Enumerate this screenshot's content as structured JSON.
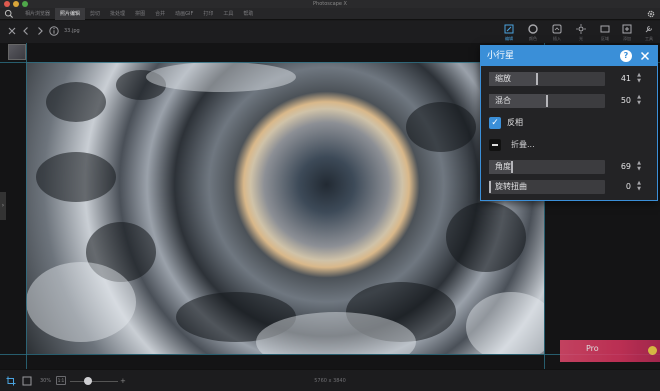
{
  "app": {
    "title": "Photoscape X"
  },
  "tabs": [
    {
      "label": "相片浏览器",
      "active": false
    },
    {
      "label": "照片编辑",
      "active": true
    },
    {
      "label": "剪切",
      "active": false
    },
    {
      "label": "批处理",
      "active": false
    },
    {
      "label": "拼图",
      "active": false
    },
    {
      "label": "合并",
      "active": false
    },
    {
      "label": "动画GIF",
      "active": false
    },
    {
      "label": "打印",
      "active": false
    },
    {
      "label": "工具",
      "active": false
    },
    {
      "label": "帮助",
      "active": false
    }
  ],
  "toolbar": {
    "file_name": "33.jpg",
    "tools": [
      {
        "label": "编辑",
        "icon": "edit-icon",
        "active": true
      },
      {
        "label": "颜色",
        "icon": "color-icon",
        "active": false
      },
      {
        "label": "插入",
        "icon": "insert-icon",
        "active": false
      },
      {
        "label": "光",
        "icon": "light-icon",
        "active": false
      },
      {
        "label": "区域",
        "icon": "region-icon",
        "active": false
      },
      {
        "label": "添加",
        "icon": "add-icon",
        "active": false
      },
      {
        "label": "工具",
        "icon": "tools-icon",
        "active": false
      }
    ]
  },
  "watermark": {
    "text": "Pro"
  },
  "statusbar": {
    "zoom": "30%",
    "fit_label": "1:1",
    "image_size": "5760 x 3840"
  },
  "panel": {
    "title": "小行星",
    "help_label": "?",
    "controls": [
      {
        "kind": "slider",
        "label": "缩放",
        "value": 41,
        "level": 0.41
      },
      {
        "kind": "slider",
        "label": "混合",
        "value": 50,
        "level": 0.5
      },
      {
        "kind": "checkbox",
        "label": "反相",
        "checked": true
      },
      {
        "kind": "fold",
        "label": "折叠..."
      },
      {
        "kind": "slider",
        "label": "角度",
        "value": 69,
        "level": 0.19
      },
      {
        "kind": "slider",
        "label": "旋转扭曲",
        "value": 0,
        "level": 0.0
      }
    ]
  },
  "colors": {
    "accent": "#3a8fd8",
    "panel_bg": "#232325",
    "canvas_bg": "#141415"
  }
}
